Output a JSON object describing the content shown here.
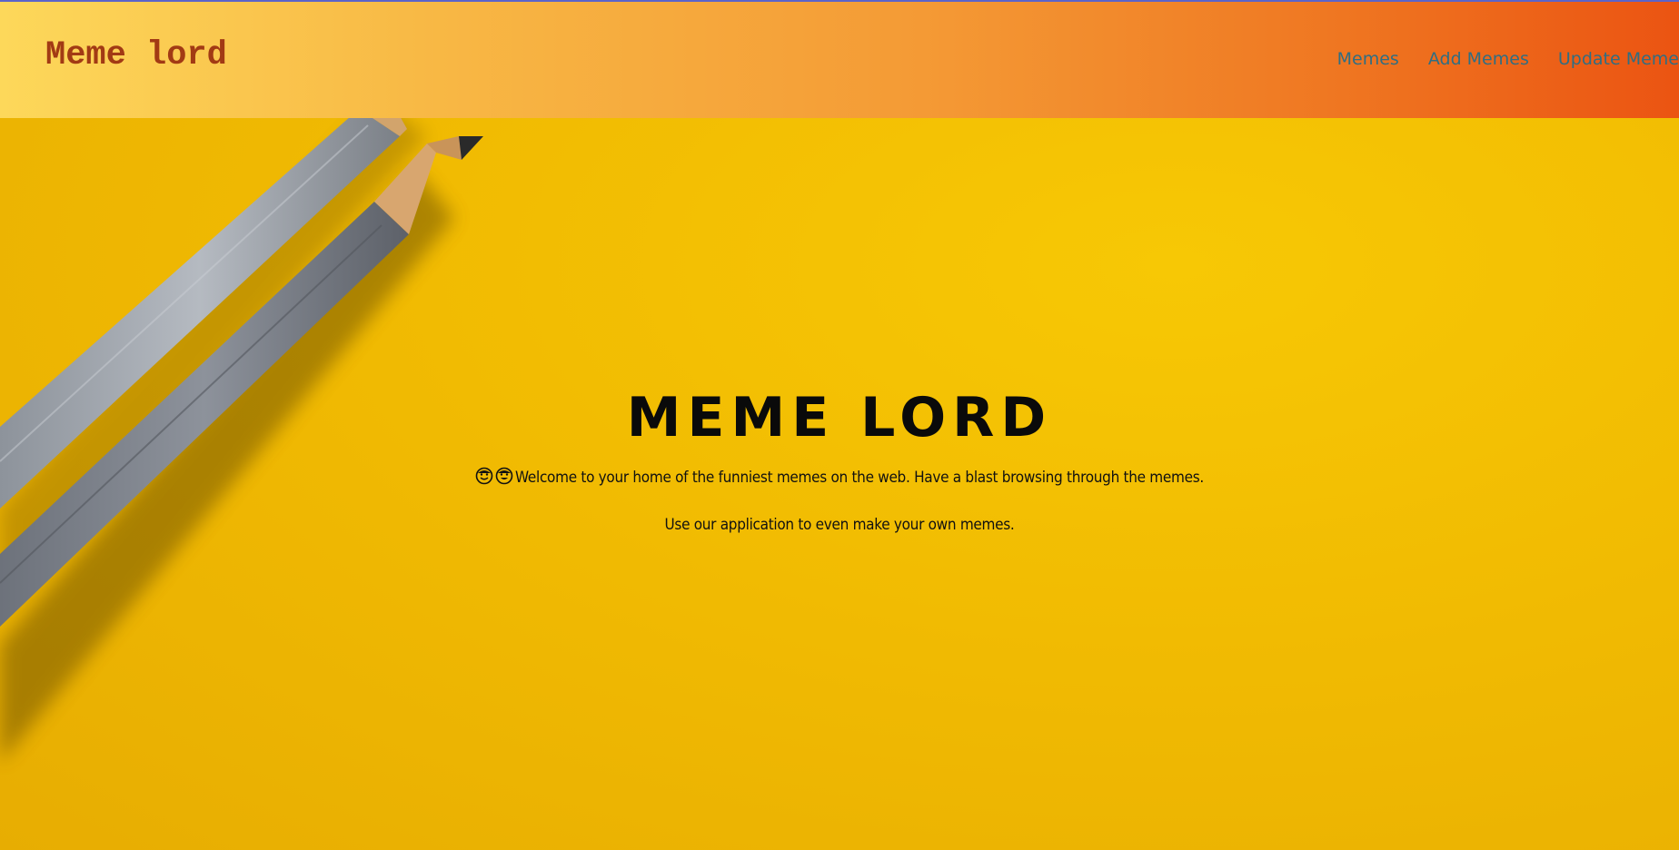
{
  "header": {
    "brand": "Meme lord",
    "nav": [
      {
        "label": "Memes"
      },
      {
        "label": "Add Memes"
      },
      {
        "label": "Update Meme"
      }
    ]
  },
  "hero": {
    "title": "MEME LORD",
    "line1": "Welcome to your home of the funniest memes on the web. Have a blast browsing through the memes.",
    "line2": "Use our application to even make your own memes.",
    "emoji_icons": [
      "smiling-face-icon",
      "grinning-face-icon"
    ]
  },
  "colors": {
    "brand": "#a23a14",
    "nav_link": "#2f6e83",
    "header_start": "#fdd85a",
    "header_end": "#eb5412",
    "hero_bg": "#f1bb02"
  }
}
